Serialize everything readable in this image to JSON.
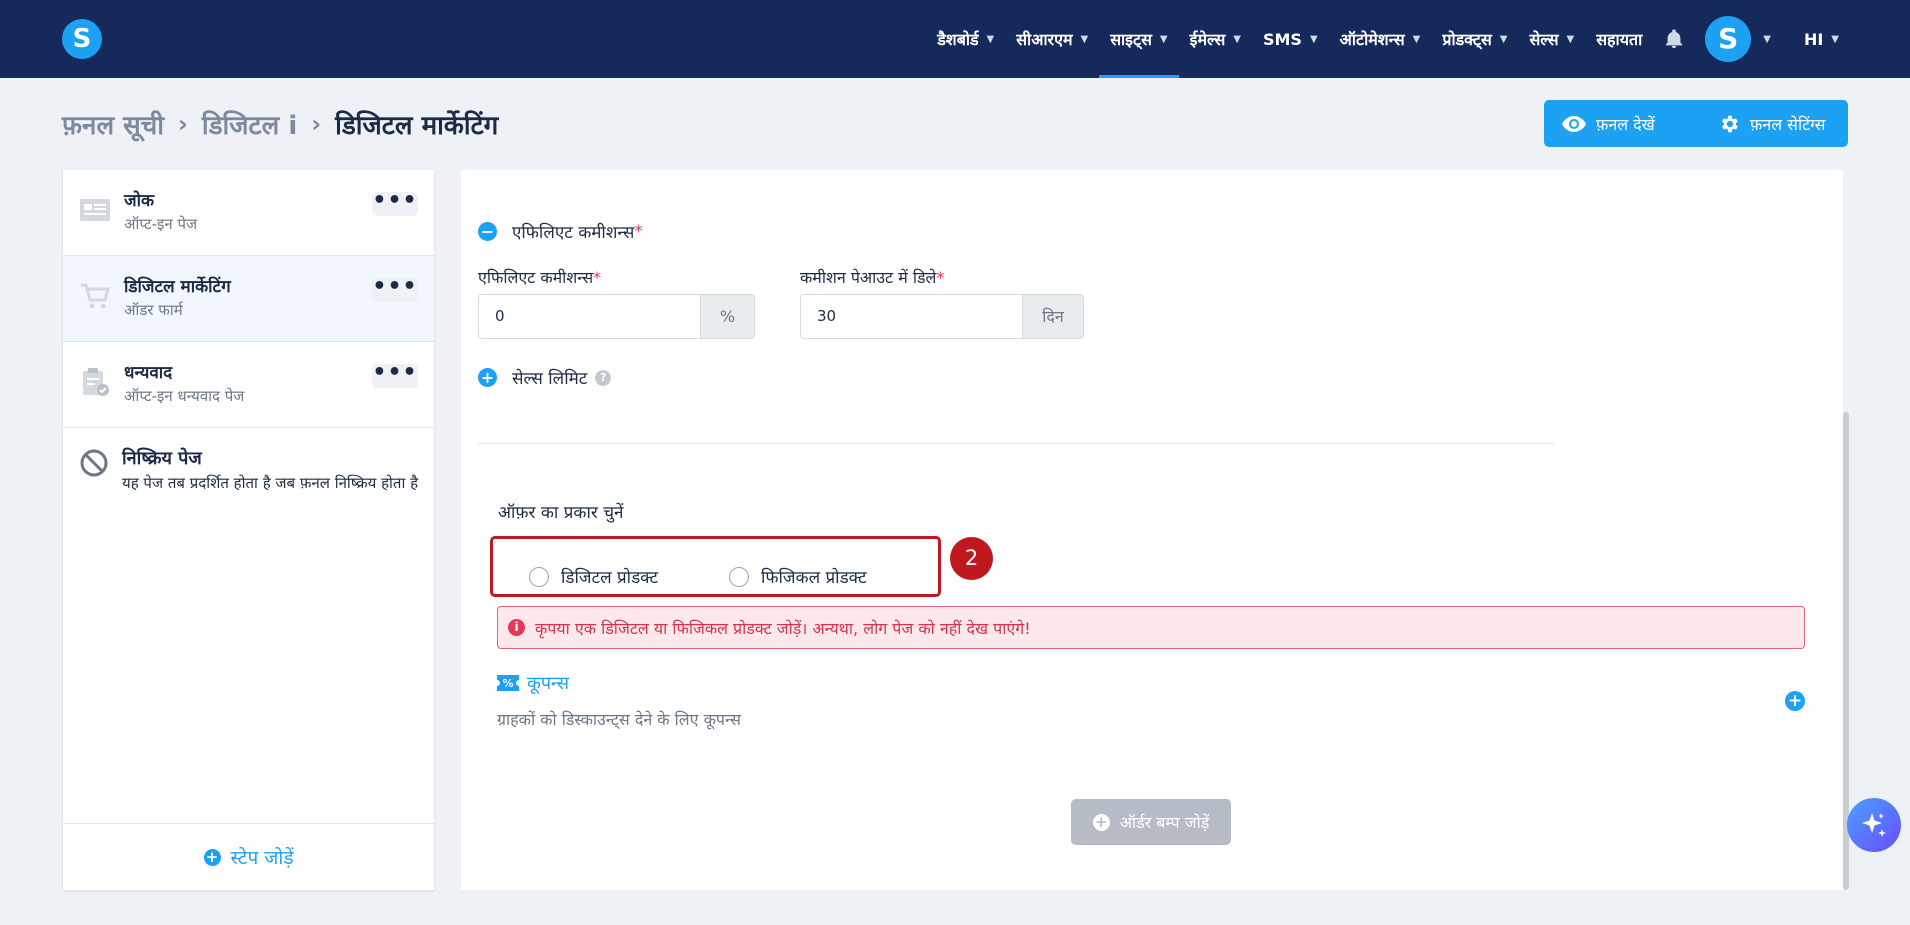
{
  "nav": {
    "logo": "S",
    "items": [
      {
        "label": "डैशबोर्ड",
        "chevron": true,
        "active": false
      },
      {
        "label": "सीआरएम",
        "chevron": true,
        "active": false
      },
      {
        "label": "साइट्स",
        "chevron": true,
        "active": true
      },
      {
        "label": "ईमेल्स",
        "chevron": true,
        "active": false
      },
      {
        "label": "SMS",
        "chevron": true,
        "active": false
      },
      {
        "label": "ऑटोमेशन्स",
        "chevron": true,
        "active": false
      },
      {
        "label": "प्रोडक्ट्स",
        "chevron": true,
        "active": false
      },
      {
        "label": "सेल्स",
        "chevron": true,
        "active": false
      },
      {
        "label": "सहायता",
        "chevron": false,
        "active": false
      }
    ],
    "avatar": "S",
    "language": "HI"
  },
  "breadcrumb": {
    "root": "फ़नल सूची",
    "mid": "डिजिटल i",
    "current": "डिजिटल मार्केटिंग"
  },
  "header_buttons": {
    "view_funnel": "फ़नल देखें",
    "funnel_settings": "फ़नल सेटिंग्स"
  },
  "steps": [
    {
      "title": "जोक",
      "subtitle": "ऑप्ट-इन पेज",
      "icon": "form-page-icon",
      "selected": false
    },
    {
      "title": "डिजिटल मार्केटिंग",
      "subtitle": "ऑडर फार्म",
      "icon": "cart-icon",
      "selected": true
    },
    {
      "title": "धन्यवाद",
      "subtitle": "ऑप्ट-इन धन्यवाद पेज",
      "icon": "clipboard-check-icon",
      "selected": false
    }
  ],
  "inactive_page": {
    "title": "निष्क्रिय पेज",
    "description": "यह पेज तब प्रदर्शित होता है जब फ़नल निष्क्रिय होता है"
  },
  "add_step": "स्टेप जोड़ें",
  "affiliate": {
    "section_title": "एफिलिएट कमीशन्स",
    "commission_label": "एफिलिएट कमीशन्स",
    "commission_value": "0",
    "commission_unit": "%",
    "delay_label": "कमीशन पेआउट में डिले",
    "delay_value": "30",
    "delay_unit": "दिन"
  },
  "sales_limit": "सेल्स लिमिट",
  "offer": {
    "label": "ऑफ़र का प्रकार चुनें",
    "options": [
      "डिजिटल प्रोडक्ट",
      "फिजिकल प्रोडक्ट"
    ],
    "annotation_number": "2"
  },
  "alert": "कृपया एक डिजिटल या फिजिकल प्रोडक्ट जोड़ें। अन्यथा, लोग पेज को नहीं देख पाएंगे!",
  "coupons": {
    "title": "कूपन्स",
    "description": "ग्राहकों को डिस्काउन्ट्स देने के लिए कूपन्स"
  },
  "order_bump": "ऑर्डर बम्प जोड़ें",
  "colors": {
    "nav_bg": "#15295a",
    "accent": "#1da1f2",
    "highlight": "#c0181f",
    "alert_text": "#d6334e"
  }
}
